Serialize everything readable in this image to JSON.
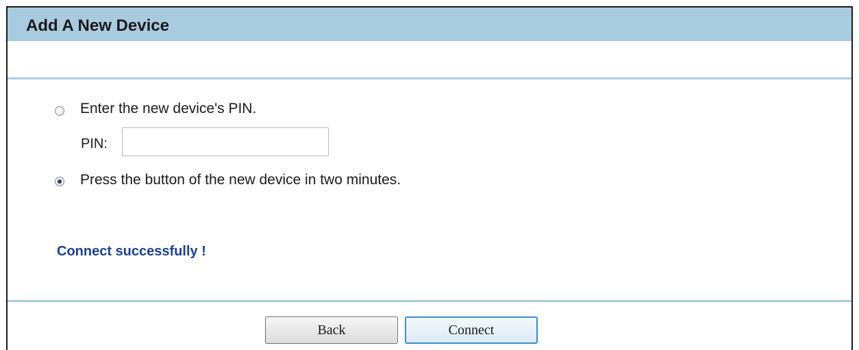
{
  "title": "Add A New Device",
  "options": {
    "pin_option_label": "Enter the new device's PIN.",
    "pin_option_checked": false,
    "pbc_option_label": "Press the button of the new device in two minutes.",
    "pbc_option_checked": true
  },
  "pin": {
    "label": "PIN:",
    "value": ""
  },
  "status_message": "Connect successfully !",
  "buttons": {
    "back_label": "Back",
    "connect_label": "Connect"
  },
  "colors": {
    "header_bar": "#a9cbe0",
    "status_text": "#1c3f99",
    "connect_border": "#3a8ecf"
  }
}
